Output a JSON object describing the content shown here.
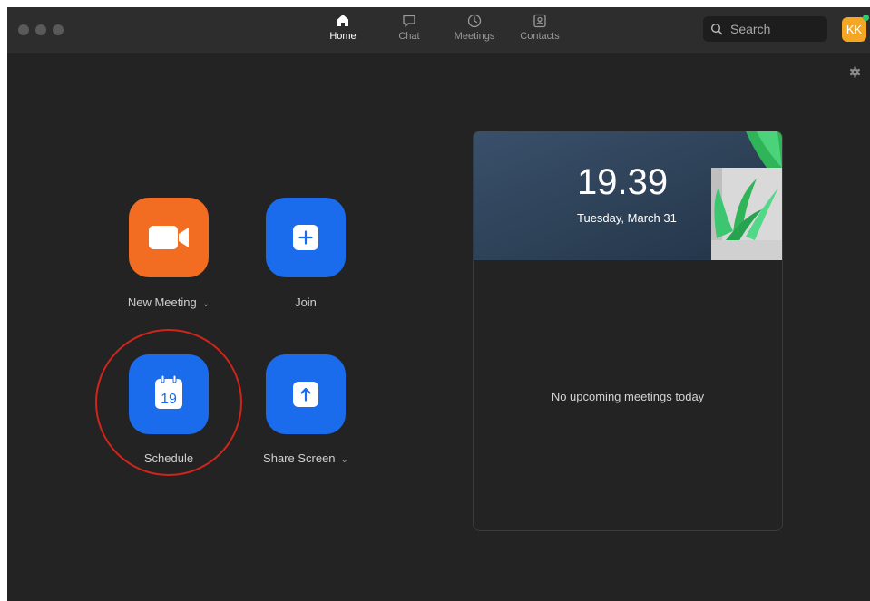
{
  "nav": {
    "items": [
      {
        "label": "Home",
        "icon": "home-icon",
        "active": true
      },
      {
        "label": "Chat",
        "icon": "chat-icon",
        "active": false
      },
      {
        "label": "Meetings",
        "icon": "clock-icon",
        "active": false
      },
      {
        "label": "Contacts",
        "icon": "contacts-icon",
        "active": false
      }
    ]
  },
  "search": {
    "placeholder": "Search"
  },
  "user": {
    "initials": "KK",
    "status_color": "#2ecc71",
    "avatar_color": "#f5a623"
  },
  "actions": {
    "new_meeting": {
      "label": "New Meeting",
      "color": "#f26d21"
    },
    "join": {
      "label": "Join",
      "color": "#1a6ced"
    },
    "schedule": {
      "label": "Schedule",
      "calendar_day": "19",
      "color": "#1a6ced"
    },
    "share_screen": {
      "label": "Share Screen",
      "color": "#1a6ced"
    }
  },
  "upcoming": {
    "time": "19.39",
    "date": "Tuesday, March 31",
    "empty_message": "No upcoming meetings today"
  },
  "annotation": {
    "highlight_color": "#d0241c"
  }
}
